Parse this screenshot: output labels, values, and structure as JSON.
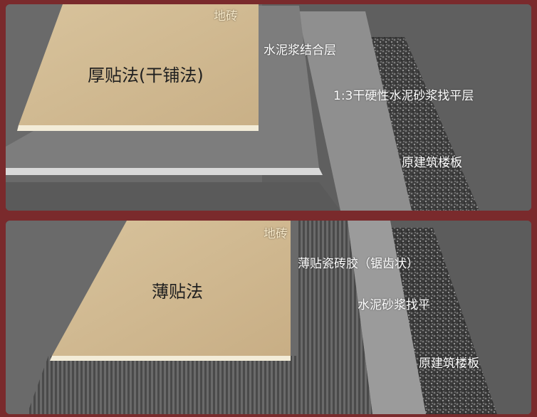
{
  "top_panel": {
    "tile_label": "地砖",
    "method_label": "厚贴法(干铺法)",
    "layer_cement_paste": "水泥浆结合层",
    "layer_dry_mortar": "1:3干硬性水泥砂浆找平层",
    "layer_slab": "原建筑楼板"
  },
  "bottom_panel": {
    "tile_label": "地砖",
    "method_label": "薄贴法",
    "layer_adhesive": "薄贴瓷砖胶（锯齿状）",
    "layer_mortar": "水泥砂浆找平",
    "layer_slab": "原建筑楼板"
  },
  "colors": {
    "frame": "#7a2a2c",
    "tile": "#d4bf98",
    "tile_edge": "#f3ecd8",
    "cement_paste": "#8d8d8d",
    "dry_mortar": "#a8a8a8",
    "slab": "#3a3a3a",
    "adhesive": "#555555",
    "mortar": "#9c9c9c"
  }
}
